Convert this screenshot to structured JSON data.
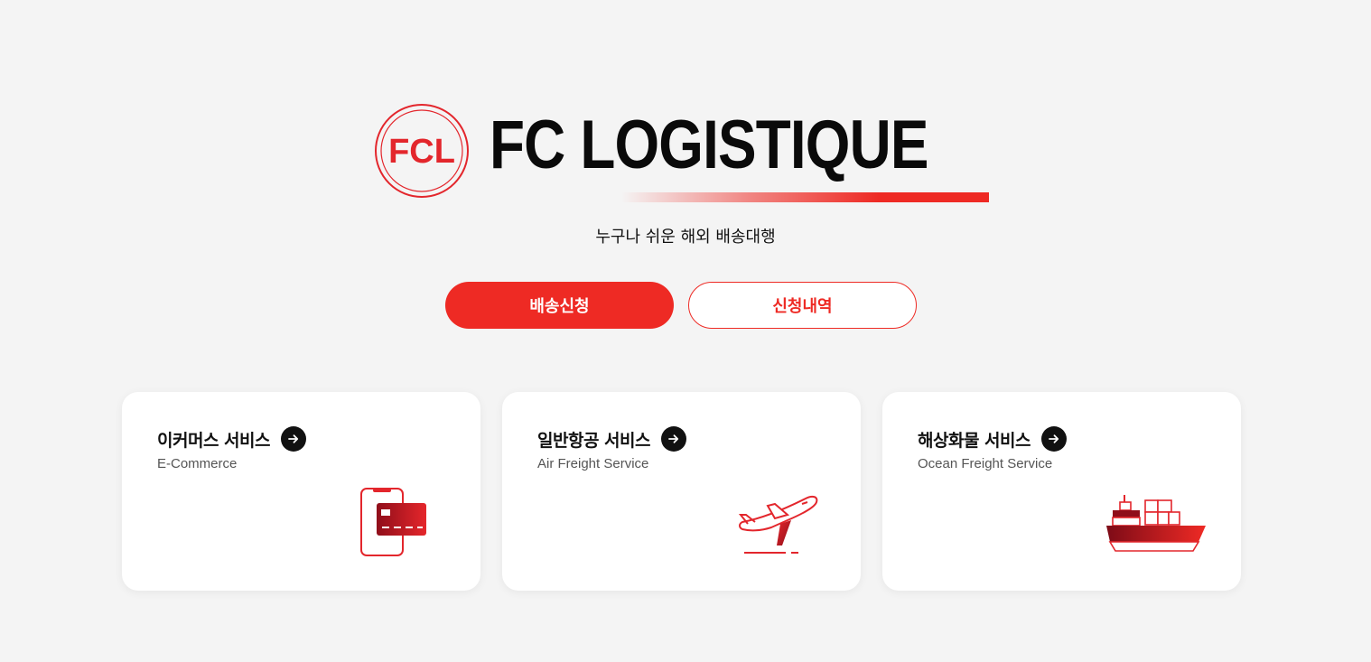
{
  "brand": {
    "emblem_text": "FCL",
    "wordmark": "FC LOGISTIQUE",
    "accent_color": "#ee2a24"
  },
  "tagline": "누구나 쉬운 해외 배송대행",
  "actions": {
    "primary_label": "배송신청",
    "secondary_label": "신청내역"
  },
  "services": [
    {
      "title": "이커머스 서비스",
      "subtitle": "E-Commerce",
      "icon": "phone-card-icon"
    },
    {
      "title": "일반항공 서비스",
      "subtitle": "Air Freight Service",
      "icon": "airplane-icon"
    },
    {
      "title": "해상화물 서비스",
      "subtitle": "Ocean Freight Service",
      "icon": "cargo-ship-icon"
    }
  ]
}
